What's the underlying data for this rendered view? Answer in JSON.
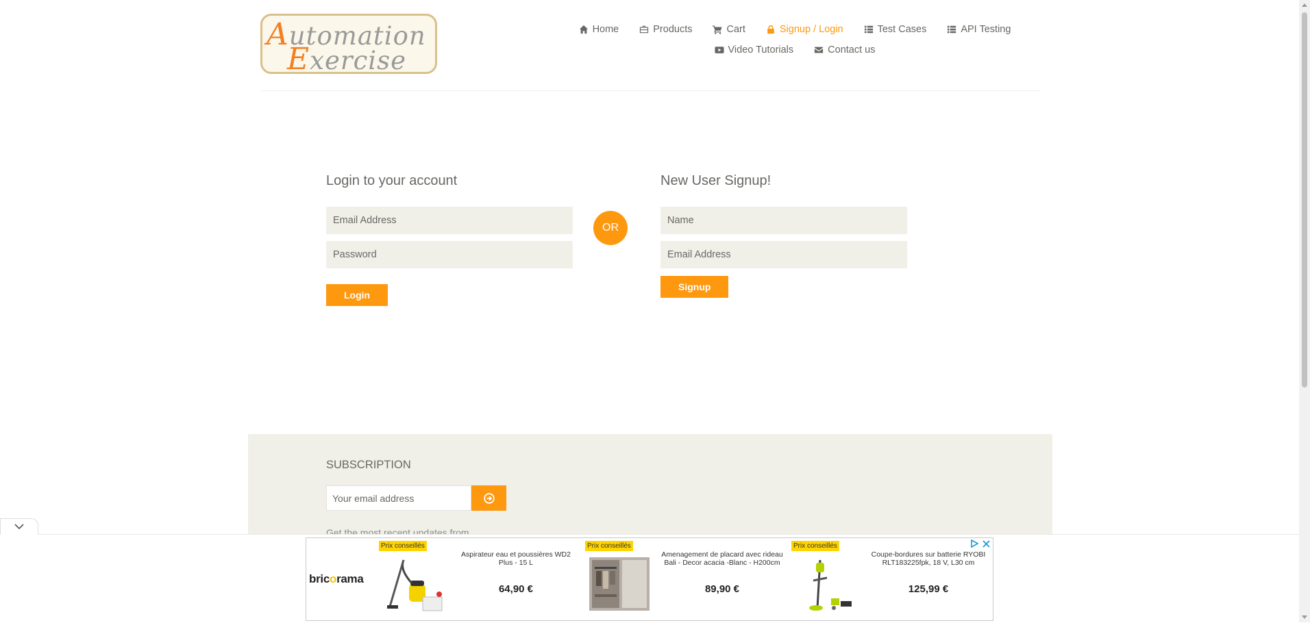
{
  "logo": {
    "word1_cap": "A",
    "word1_rest": "utomation",
    "word2_cap": "E",
    "word2_rest": "xercise"
  },
  "nav": {
    "home": "Home",
    "products": "Products",
    "cart": "Cart",
    "signup_login": "Signup / Login",
    "test_cases": "Test Cases",
    "api_testing": "API Testing",
    "video_tutorials": "Video Tutorials",
    "contact_us": "Contact us"
  },
  "login": {
    "title": "Login to your account",
    "email_placeholder": "Email Address",
    "password_placeholder": "Password",
    "button": "Login"
  },
  "or_label": "OR",
  "signup": {
    "title": "New User Signup!",
    "name_placeholder": "Name",
    "email_placeholder": "Email Address",
    "button": "Signup"
  },
  "footer": {
    "subscription_title": "SUBSCRIPTION",
    "email_placeholder": "Your email address",
    "note": "Get the most recent updates from"
  },
  "ad": {
    "brand_part1": "bric",
    "brand_dot": "o",
    "brand_part2": "rama",
    "products": [
      {
        "badge": "Prix conseillés",
        "title": "Aspirateur eau et poussières WD2 Plus - 15 L",
        "price": "64,90 €",
        "icon": "vacuum-cleaner-image"
      },
      {
        "badge": "Prix conseillés",
        "title": "Amenagement de placard avec rideau Bali - Decor acacia -Blanc - H200cm",
        "price": "89,90 €",
        "icon": "wardrobe-image"
      },
      {
        "badge": "Prix conseillés",
        "title": "Coupe-bordures sur batterie RYOBI RLT183225fpk, 18 V, L30 cm",
        "price": "125,99 €",
        "icon": "grass-trimmer-image"
      }
    ]
  },
  "colors": {
    "accent": "#fe980f",
    "text": "#696763",
    "field_bg": "#f0f0e9",
    "footer_bg": "#f0f0e9"
  }
}
